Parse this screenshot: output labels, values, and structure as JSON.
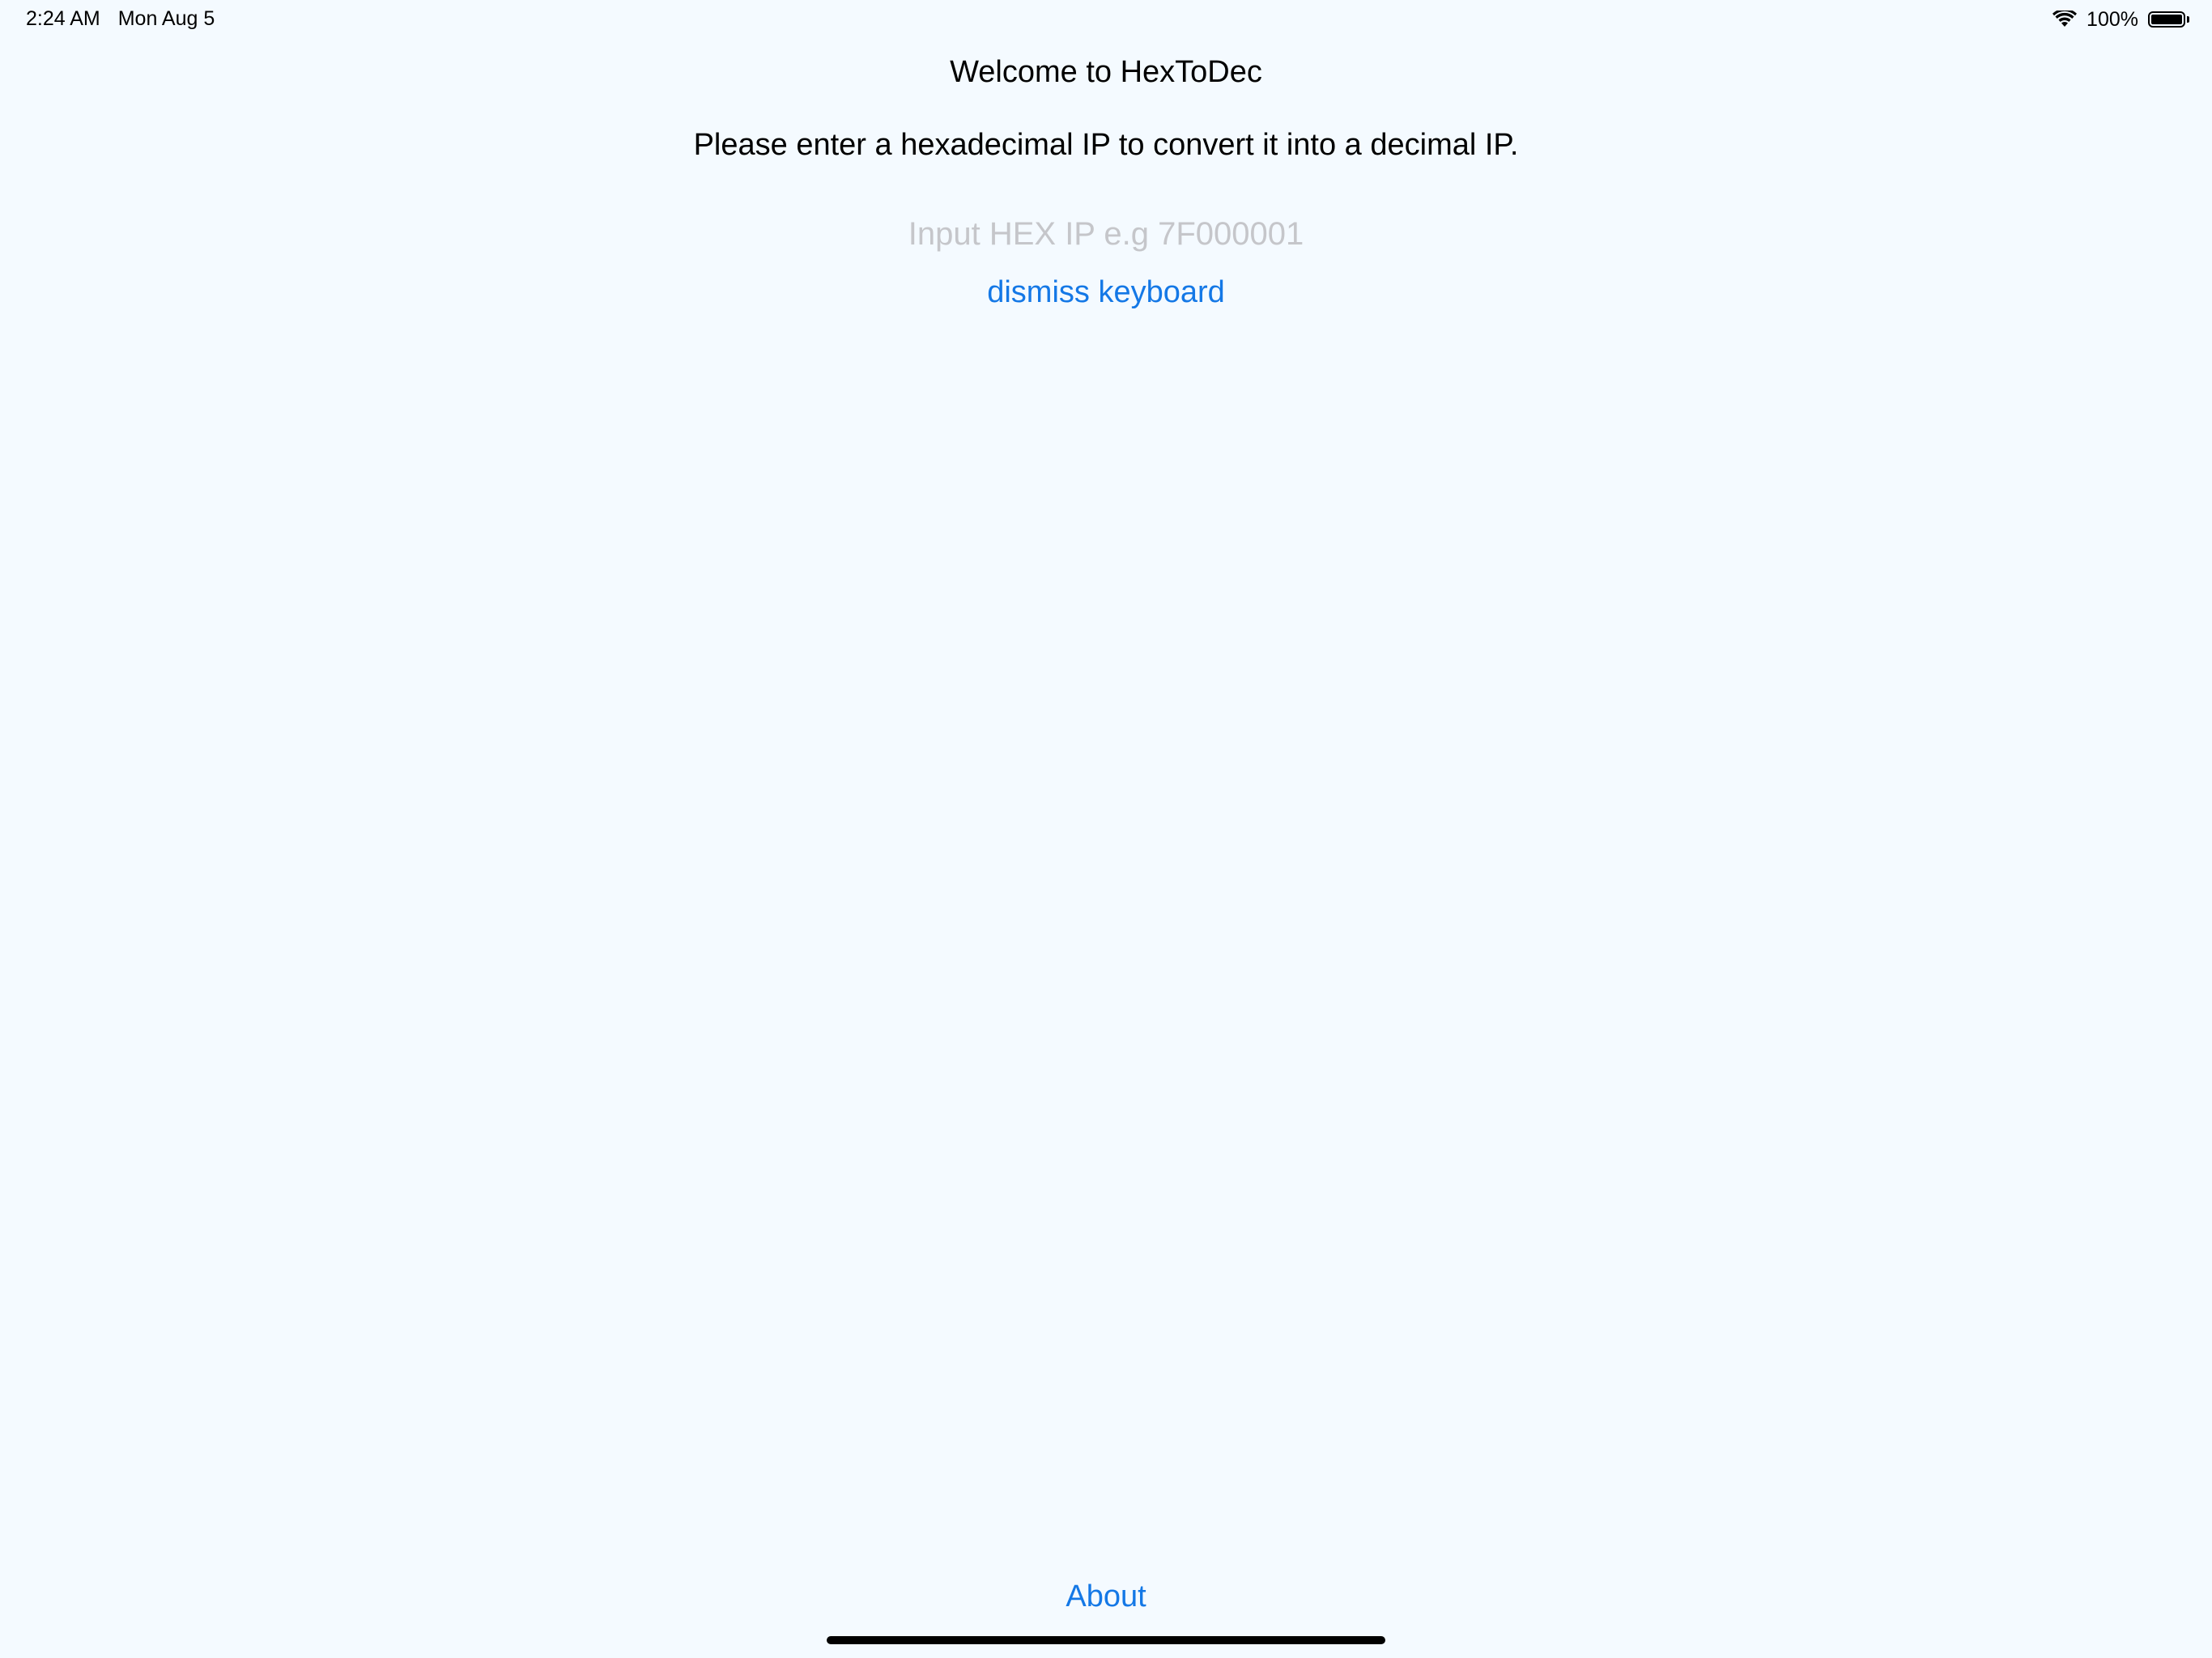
{
  "status_bar": {
    "time": "2:24 AM",
    "date": "Mon Aug 5",
    "battery_percent_label": "100%",
    "battery_level": 1.0
  },
  "main": {
    "title": "Welcome to HexToDec",
    "subtitle": "Please enter a hexadecimal IP to convert it into a decimal IP.",
    "hex_input": {
      "value": "",
      "placeholder": "Input HEX IP e.g 7F000001"
    },
    "dismiss_label": "dismiss keyboard",
    "about_label": "About"
  },
  "colors": {
    "background": "#f4faff",
    "link": "#1478e6",
    "placeholder": "#c5c6ca",
    "text": "#000000"
  },
  "icons": {
    "wifi": "wifi-icon",
    "battery": "battery-icon"
  }
}
